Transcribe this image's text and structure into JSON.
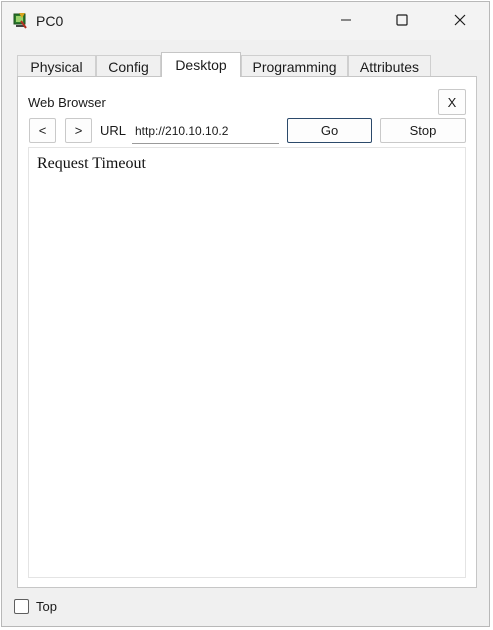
{
  "window": {
    "title": "PC0",
    "icon": "packet-tracer-pc-icon",
    "controls": {
      "minimize": "minimize-icon",
      "maximize": "maximize-icon",
      "close": "close-icon"
    }
  },
  "tabs": [
    {
      "label": "Physical",
      "active": false
    },
    {
      "label": "Config",
      "active": false
    },
    {
      "label": "Desktop",
      "active": true
    },
    {
      "label": "Programming",
      "active": false
    },
    {
      "label": "Attributes",
      "active": false
    }
  ],
  "browser": {
    "title": "Web Browser",
    "close_label": "X",
    "back_label": "<",
    "forward_label": ">",
    "url_label": "URL",
    "url_value": "http://210.10.10.2",
    "go_label": "Go",
    "stop_label": "Stop",
    "content_text": "Request Timeout"
  },
  "footer": {
    "top_label": "Top",
    "top_checked": false
  },
  "colors": {
    "window_bg": "#f0f0f0",
    "panel_bg": "#ffffff",
    "go_border": "#2c4a6b"
  }
}
